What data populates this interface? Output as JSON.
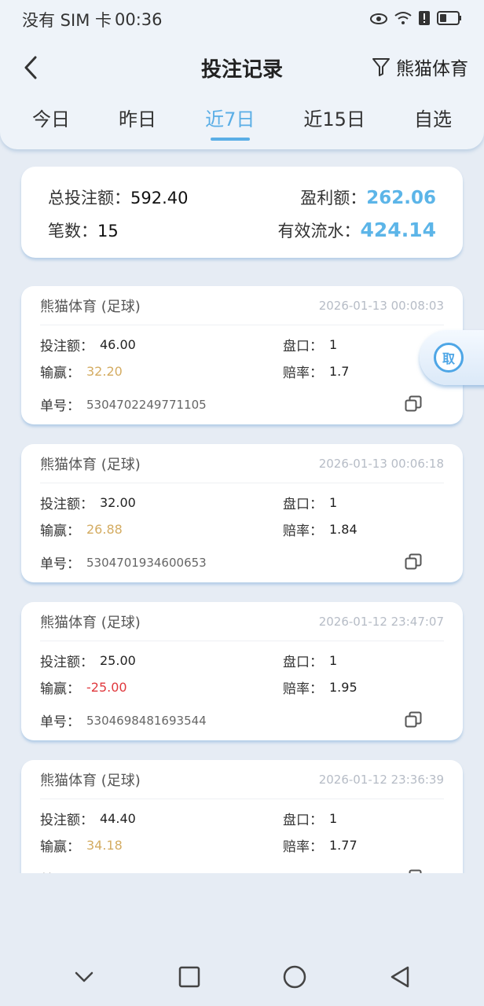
{
  "status_bar": {
    "carrier": "没有 SIM 卡",
    "time": "00:36"
  },
  "nav": {
    "title": "投注记录",
    "filter_label": "熊猫体育"
  },
  "tabs": [
    {
      "label": "今日",
      "active": false
    },
    {
      "label": "昨日",
      "active": false
    },
    {
      "label": "近7日",
      "active": true
    },
    {
      "label": "近15日",
      "active": false
    },
    {
      "label": "自选",
      "active": false
    }
  ],
  "summary": {
    "total_label": "总投注额：",
    "total_value": "592.40",
    "profit_label": "盈利额：",
    "profit_value": "262.06",
    "count_label": "笔数：",
    "count_value": "15",
    "flow_label": "有效流水：",
    "flow_value": "424.14"
  },
  "labels": {
    "bet_amount": "投注额：",
    "handicap": "盘口：",
    "win_loss": "输赢：",
    "odds": "赔率：",
    "order_no": "单号："
  },
  "records": [
    {
      "provider": "熊猫体育 (足球)",
      "time": "2026-01-13 00:08:03",
      "bet_amount": "46.00",
      "handicap": "1",
      "win_loss": "32.20",
      "result": "win",
      "odds": "1.7",
      "order_no": "5304702249771105"
    },
    {
      "provider": "熊猫体育 (足球)",
      "time": "2026-01-13 00:06:18",
      "bet_amount": "32.00",
      "handicap": "1",
      "win_loss": "26.88",
      "result": "win",
      "odds": "1.84",
      "order_no": "5304701934600653"
    },
    {
      "provider": "熊猫体育 (足球)",
      "time": "2026-01-12 23:47:07",
      "bet_amount": "25.00",
      "handicap": "1",
      "win_loss": "-25.00",
      "result": "loss",
      "odds": "1.95",
      "order_no": "5304698481693544"
    },
    {
      "provider": "熊猫体育 (足球)",
      "time": "2026-01-12 23:36:39",
      "bet_amount": "44.40",
      "handicap": "1",
      "win_loss": "34.18",
      "result": "win",
      "odds": "1.77",
      "order_no": ""
    }
  ],
  "float_button": {
    "label": "取"
  },
  "colors": {
    "accent": "#5aaee6",
    "win": "#d4ac62",
    "loss": "#e0393e"
  }
}
